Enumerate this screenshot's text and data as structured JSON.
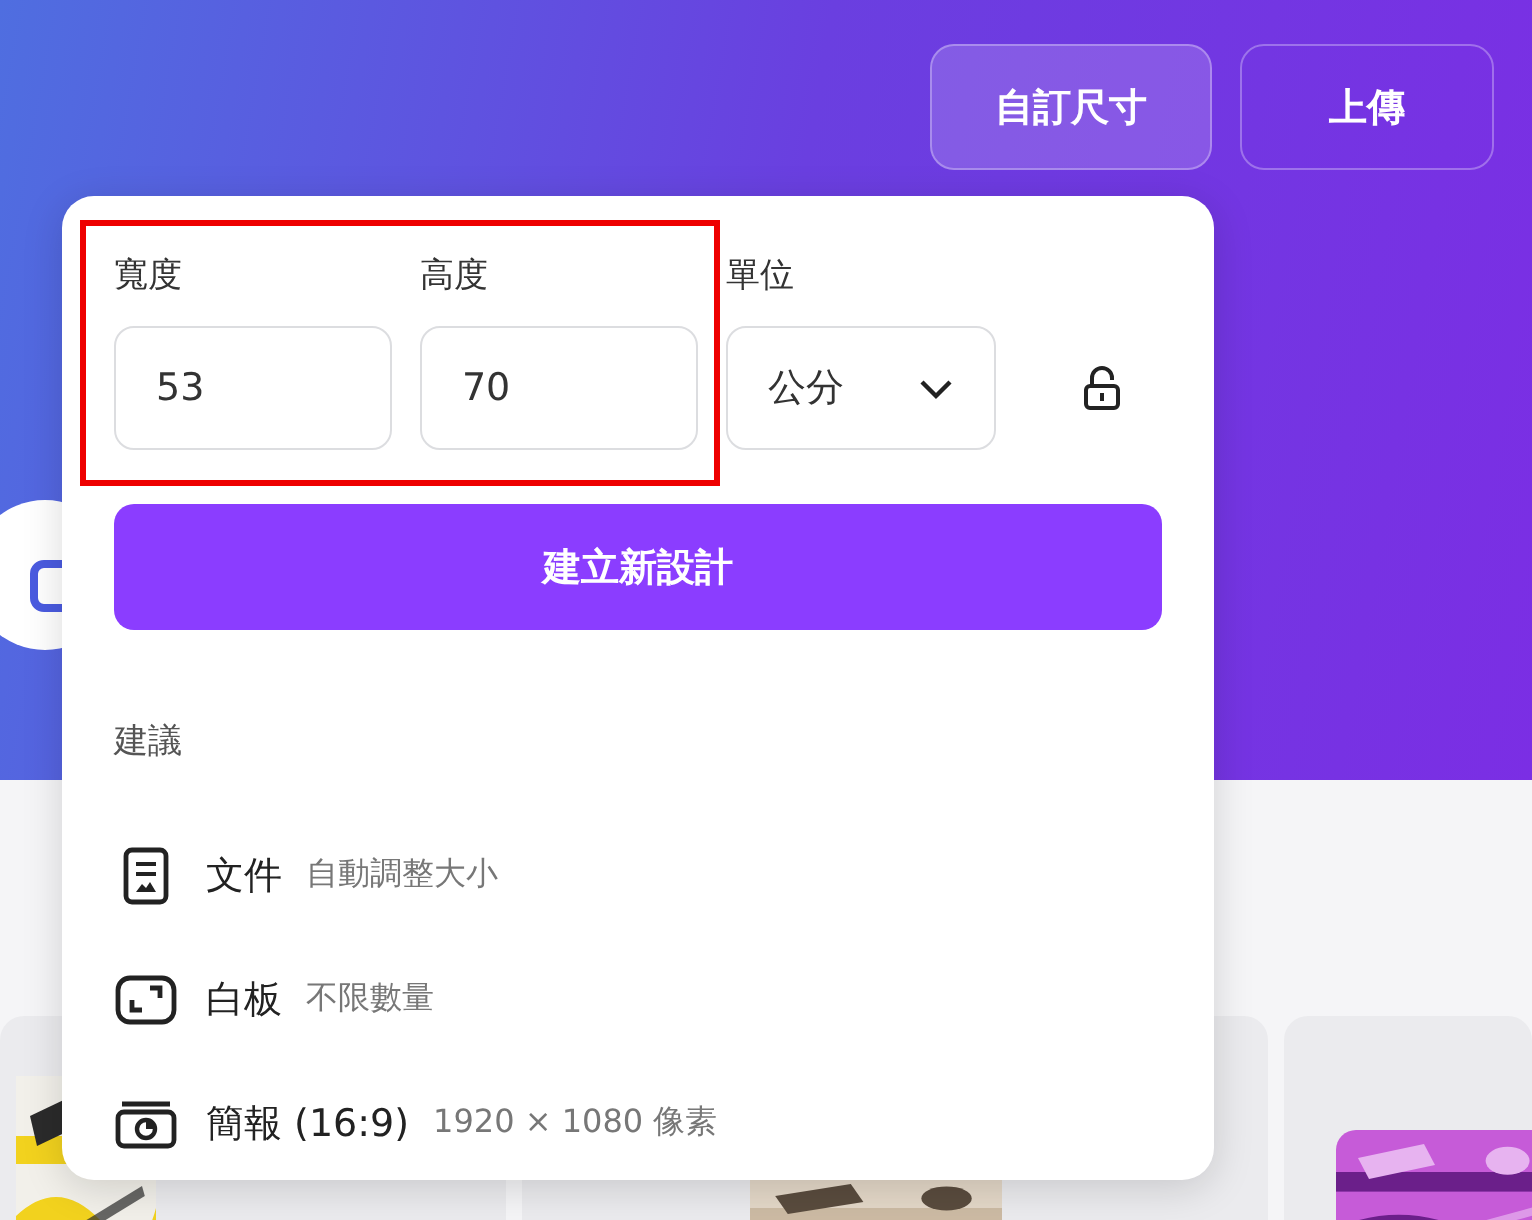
{
  "header_buttons": [
    {
      "label": "自訂尺寸",
      "selected": true
    },
    {
      "label": "上傳",
      "selected": false
    }
  ],
  "custom_size_popup": {
    "width": {
      "label": "寬度",
      "value": "53"
    },
    "height": {
      "label": "高度",
      "value": "70"
    },
    "unit": {
      "label": "單位",
      "value": "公分"
    },
    "aspect_locked": false,
    "create_button": "建立新設計",
    "suggestions_heading": "建議",
    "suggestions": [
      {
        "kind": "doc",
        "name": "文件",
        "detail": "自動調整大小"
      },
      {
        "kind": "whiteboard",
        "name": "白板",
        "detail": "不限數量"
      },
      {
        "kind": "presentation",
        "name": "簡報 (16:9)",
        "detail": "1920 × 1080 像素"
      }
    ]
  }
}
